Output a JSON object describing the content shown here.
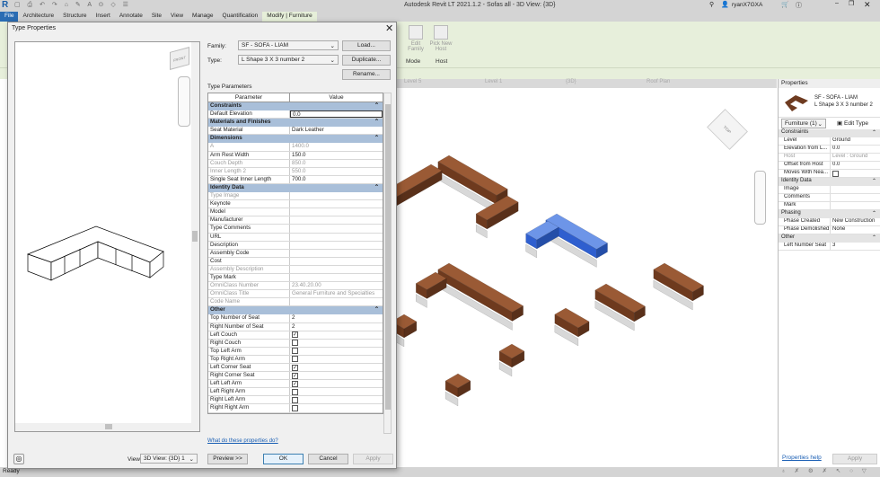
{
  "app": {
    "title": "Autodesk Revit LT 2021.1.2 - Sofas all - 3D View: {3D}",
    "user": "ryanX7GXA",
    "status": "Ready"
  },
  "ribbon_tabs": [
    "File",
    "Architecture",
    "Structure",
    "Insert",
    "Annotate",
    "Site",
    "View",
    "Manage",
    "Quantification",
    "Modify | Furniture"
  ],
  "ribbon": {
    "edit_family": "Edit Family",
    "pick_new_host": "Pick New Host",
    "mode_group": "Mode",
    "host_group": "Host"
  },
  "view_tabs": [
    "Level 5",
    "Level 1",
    "{3D}",
    "Roof Plan"
  ],
  "dialog": {
    "title": "Type Properties",
    "family_label": "Family:",
    "family_value": "SF - SOFA - LIAM",
    "type_label": "Type:",
    "type_value": "L Shape 3 X 3 number 2",
    "load": "Load...",
    "duplicate": "Duplicate...",
    "rename": "Rename...",
    "type_params_label": "Type Parameters",
    "col_param": "Parameter",
    "col_value": "Value",
    "groups": [
      {
        "name": "Constraints",
        "rows": [
          {
            "k": "Default Elevation",
            "v": "0.0",
            "edit": true
          }
        ]
      },
      {
        "name": "Materials and Finishes",
        "rows": [
          {
            "k": "Seat Material",
            "v": "Dark Leather"
          }
        ]
      },
      {
        "name": "Dimensions",
        "rows": [
          {
            "k": "A",
            "v": "1400.0",
            "dis": true
          },
          {
            "k": "Arm Rest Width",
            "v": "150.0"
          },
          {
            "k": "Couch Depth",
            "v": "850.0",
            "dis": true
          },
          {
            "k": "Inner Length 2",
            "v": "550.0",
            "dis": true
          },
          {
            "k": "Single Seat Inner Length",
            "v": "700.0"
          }
        ]
      },
      {
        "name": "Identity Data",
        "rows": [
          {
            "k": "Type Image",
            "v": "",
            "dis": true
          },
          {
            "k": "Keynote",
            "v": ""
          },
          {
            "k": "Model",
            "v": ""
          },
          {
            "k": "Manufacturer",
            "v": ""
          },
          {
            "k": "Type Comments",
            "v": ""
          },
          {
            "k": "URL",
            "v": ""
          },
          {
            "k": "Description",
            "v": ""
          },
          {
            "k": "Assembly Code",
            "v": ""
          },
          {
            "k": "Cost",
            "v": ""
          },
          {
            "k": "Assembly Description",
            "v": "",
            "dis": true
          },
          {
            "k": "Type Mark",
            "v": ""
          },
          {
            "k": "OmniClass Number",
            "v": "23.40.20.00",
            "dis": true
          },
          {
            "k": "OmniClass Title",
            "v": "General Furniture and Specialties",
            "dis": true
          },
          {
            "k": "Code Name",
            "v": "",
            "dis": true
          }
        ]
      },
      {
        "name": "Other",
        "rows": [
          {
            "k": "Top Number of Seat",
            "v": "2"
          },
          {
            "k": "Right Number of Seat",
            "v": "2"
          },
          {
            "k": "Left Couch",
            "check": true
          },
          {
            "k": "Right Couch",
            "check": false
          },
          {
            "k": "Top Left Arm",
            "check": false
          },
          {
            "k": "Top Right Arm",
            "check": false
          },
          {
            "k": "Left Corner Seat",
            "check": true
          },
          {
            "k": "Right Corner Seat",
            "check": true
          },
          {
            "k": "Left Left Arm",
            "check": true
          },
          {
            "k": "Left Right Arm",
            "check": false
          },
          {
            "k": "Right Left Arm",
            "check": false
          },
          {
            "k": "Right Right Arm",
            "check": false
          }
        ]
      }
    ],
    "help_link": "What do these properties do?",
    "view_label": "View:",
    "view_value": "3D View: {3D} 1",
    "preview": "Preview >>",
    "ok": "OK",
    "cancel": "Cancel",
    "apply": "Apply"
  },
  "properties": {
    "title": "Properties",
    "family": "SF - SOFA - LIAM",
    "type": "L Shape 3 X 3 number 2",
    "selector": "Furniture (1)",
    "edit_type": "Edit Type",
    "groups": [
      {
        "name": "Constraints",
        "rows": [
          {
            "k": "Level",
            "v": "Ground"
          },
          {
            "k": "Elevation from L...",
            "v": "0.0"
          },
          {
            "k": "Host",
            "v": "Level : Ground",
            "dis": true
          },
          {
            "k": "Offset from Host",
            "v": "0.0"
          },
          {
            "k": "Moves With Nea...",
            "check": false
          }
        ]
      },
      {
        "name": "Identity Data",
        "rows": [
          {
            "k": "Image",
            "v": ""
          },
          {
            "k": "Comments",
            "v": ""
          },
          {
            "k": "Mark",
            "v": ""
          }
        ]
      },
      {
        "name": "Phasing",
        "rows": [
          {
            "k": "Phase Created",
            "v": "New Construction"
          },
          {
            "k": "Phase Demolished",
            "v": "None"
          }
        ]
      },
      {
        "name": "Other",
        "rows": [
          {
            "k": "Left Number Seat",
            "v": "3"
          }
        ]
      }
    ],
    "help": "Properties help",
    "apply": "Apply"
  },
  "colors": {
    "selected": "#3a6fd8",
    "sofa": "#7a4526",
    "ribbon": "#e7efdb",
    "group_header": "#a9bfd9"
  }
}
